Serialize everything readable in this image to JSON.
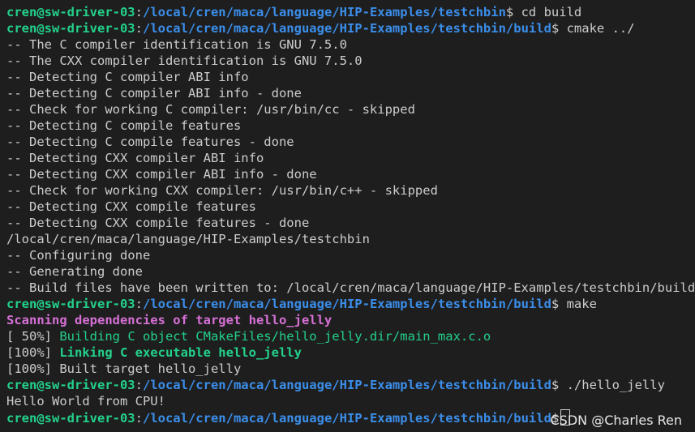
{
  "prompt": {
    "user": "cren@sw-driver-03",
    "colon": ":",
    "dollar": "$"
  },
  "colors": {
    "background": "#1e1e1e",
    "text": "#cccccc",
    "user": "#23d18b",
    "path": "#3b8eea",
    "magenta": "#d670d6",
    "green": "#23d18b"
  },
  "lines": [
    {
      "path": "/local/cren/maca/language/HIP-Examples/testchbin",
      "cmd": " cd build"
    },
    {
      "path": "/local/cren/maca/language/HIP-Examples/testchbin/build",
      "cmd": " cmake ../"
    },
    {
      "text": "-- The C compiler identification is GNU 7.5.0"
    },
    {
      "text": "-- The CXX compiler identification is GNU 7.5.0"
    },
    {
      "text": "-- Detecting C compiler ABI info"
    },
    {
      "text": "-- Detecting C compiler ABI info - done"
    },
    {
      "text": "-- Check for working C compiler: /usr/bin/cc - skipped"
    },
    {
      "text": "-- Detecting C compile features"
    },
    {
      "text": "-- Detecting C compile features - done"
    },
    {
      "text": "-- Detecting CXX compiler ABI info"
    },
    {
      "text": "-- Detecting CXX compiler ABI info - done"
    },
    {
      "text": "-- Check for working CXX compiler: /usr/bin/c++ - skipped"
    },
    {
      "text": "-- Detecting CXX compile features"
    },
    {
      "text": "-- Detecting CXX compile features - done"
    },
    {
      "text": "/local/cren/maca/language/HIP-Examples/testchbin"
    },
    {
      "text": "-- Configuring done"
    },
    {
      "text": "-- Generating done"
    },
    {
      "text": "-- Build files have been written to: /local/cren/maca/language/HIP-Examples/testchbin/build"
    },
    {
      "path": "/local/cren/maca/language/HIP-Examples/testchbin/build",
      "cmd": " make"
    },
    {
      "text": "Scanning dependencies of target hello_jelly",
      "style": "magenta"
    },
    {
      "prefix": "[ 50%] ",
      "text": "Building C object CMakeFiles/hello_jelly.dir/main_max.c.o",
      "style": "green"
    },
    {
      "prefix": "[100%] ",
      "text": "Linking C executable hello_jelly",
      "style": "bgreen"
    },
    {
      "text": "[100%] Built target hello_jelly"
    },
    {
      "path": "/local/cren/maca/language/HIP-Examples/testchbin/build",
      "cmd": " ./hello_jelly"
    },
    {
      "text": "Hello World from CPU!"
    },
    {
      "path": "/local/cren/maca/language/HIP-Examples/testchbin/build",
      "cmd": "",
      "cursor": true
    }
  ],
  "watermark": "CSDN @Charles Ren"
}
